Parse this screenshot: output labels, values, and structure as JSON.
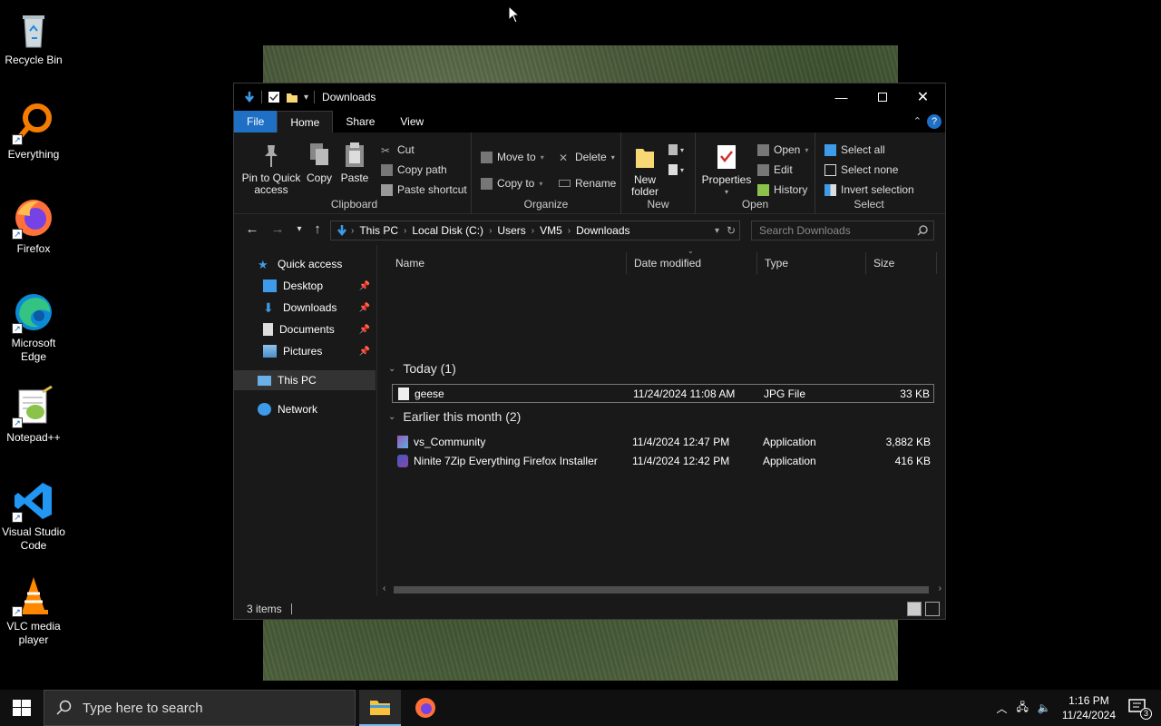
{
  "desktop": {
    "icons": [
      {
        "label": "Recycle Bin"
      },
      {
        "label": "Everything"
      },
      {
        "label": "Firefox"
      },
      {
        "label": "Microsoft Edge"
      },
      {
        "label": "Notepad++"
      },
      {
        "label": "Visual Studio Code"
      },
      {
        "label": "VLC media player"
      }
    ]
  },
  "window": {
    "title": "Downloads",
    "tabs": {
      "file": "File",
      "home": "Home",
      "share": "Share",
      "view": "View"
    },
    "ribbon": {
      "clipboard": {
        "pin_label": "Pin to Quick access",
        "copy_label": "Copy",
        "paste_label": "Paste",
        "cut_label": "Cut",
        "copy_path_label": "Copy path",
        "paste_shortcut_label": "Paste shortcut",
        "group_label": "Clipboard"
      },
      "organize": {
        "move_to_label": "Move to",
        "copy_to_label": "Copy to",
        "delete_label": "Delete",
        "rename_label": "Rename",
        "group_label": "Organize"
      },
      "new": {
        "new_folder_label": "New folder",
        "group_label": "New"
      },
      "open": {
        "properties_label": "Properties",
        "open_label": "Open",
        "edit_label": "Edit",
        "history_label": "History",
        "group_label": "Open"
      },
      "select": {
        "select_all_label": "Select all",
        "select_none_label": "Select none",
        "invert_label": "Invert selection",
        "group_label": "Select"
      }
    },
    "address": {
      "crumbs": [
        "This PC",
        "Local Disk (C:)",
        "Users",
        "VM5",
        "Downloads"
      ],
      "search_placeholder": "Search Downloads"
    },
    "nav": {
      "quick_access": "Quick access",
      "desktop": "Desktop",
      "downloads": "Downloads",
      "documents": "Documents",
      "pictures": "Pictures",
      "this_pc": "This PC",
      "network": "Network"
    },
    "columns": {
      "name": "Name",
      "date": "Date modified",
      "type": "Type",
      "size": "Size"
    },
    "groups": {
      "today": "Today (1)",
      "earlier": "Earlier this month (2)"
    },
    "files": [
      {
        "name": "geese",
        "date": "11/24/2024 11:08 AM",
        "type": "JPG File",
        "size": "33 KB"
      },
      {
        "name": "vs_Community",
        "date": "11/4/2024 12:47 PM",
        "type": "Application",
        "size": "3,882 KB"
      },
      {
        "name": "Ninite 7Zip Everything Firefox Installer",
        "date": "11/4/2024 12:42 PM",
        "type": "Application",
        "size": "416 KB"
      }
    ],
    "status": {
      "items": "3 items"
    }
  },
  "taskbar": {
    "search_placeholder": "Type here to search",
    "time": "1:16 PM",
    "date": "11/24/2024",
    "notification_count": "3"
  }
}
